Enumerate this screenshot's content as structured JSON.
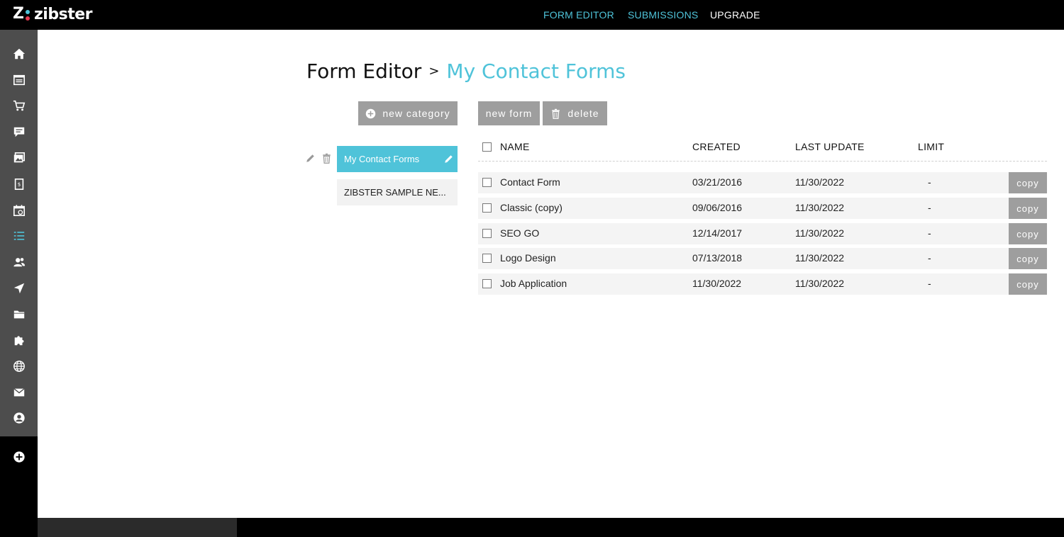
{
  "app": {
    "logo_text": "zibster",
    "logo_mark": "Z"
  },
  "topnav": {
    "form_editor": "FORM EDITOR",
    "submissions": "SUBMISSIONS",
    "upgrade": "UPGRADE"
  },
  "sidebar": {
    "items": [
      {
        "icon": "home-icon"
      },
      {
        "icon": "website-icon"
      },
      {
        "icon": "shopping-cart-icon"
      },
      {
        "icon": "chat-icon"
      },
      {
        "icon": "gallery-icon"
      },
      {
        "icon": "invoice-icon"
      },
      {
        "icon": "calendar-icon"
      },
      {
        "icon": "forms-list-icon",
        "active": true
      },
      {
        "icon": "contacts-icon"
      },
      {
        "icon": "send-icon"
      },
      {
        "icon": "folder-icon"
      },
      {
        "icon": "puzzle-icon"
      },
      {
        "icon": "globe-icon"
      },
      {
        "icon": "mail-icon"
      },
      {
        "icon": "user-icon"
      }
    ],
    "add_icon": "add-icon",
    "active_color": "#4fc3d9"
  },
  "breadcrumb": {
    "root": "Form Editor",
    "separator": ">",
    "current": "My Contact Forms"
  },
  "toolbar": {
    "new_category": "new category",
    "new_form": "new form",
    "delete": "delete"
  },
  "categories": [
    {
      "label": "My Contact Forms",
      "active": true
    },
    {
      "label": "ZIBSTER SAMPLE NE...",
      "active": false
    }
  ],
  "table": {
    "headers": {
      "name": "NAME",
      "created": "CREATED",
      "last_update": "LAST UPDATE",
      "limit": "LIMIT"
    },
    "rows": [
      {
        "name": "Contact Form",
        "created": "03/21/2016",
        "last_update": "11/30/2022",
        "limit": "-",
        "action": "copy"
      },
      {
        "name": "Classic (copy)",
        "created": "09/06/2016",
        "last_update": "11/30/2022",
        "limit": "-",
        "action": "copy"
      },
      {
        "name": "SEO GO",
        "created": "12/14/2017",
        "last_update": "11/30/2022",
        "limit": "-",
        "action": "copy"
      },
      {
        "name": "Logo Design",
        "created": "07/13/2018",
        "last_update": "11/30/2022",
        "limit": "-",
        "action": "copy"
      },
      {
        "name": "Job Application",
        "created": "11/30/2022",
        "last_update": "11/30/2022",
        "limit": "-",
        "action": "copy"
      }
    ]
  },
  "colors": {
    "accent": "#4fc3d9",
    "logo_dot_red": "#e53950",
    "button_gray": "#9e9e9e"
  }
}
